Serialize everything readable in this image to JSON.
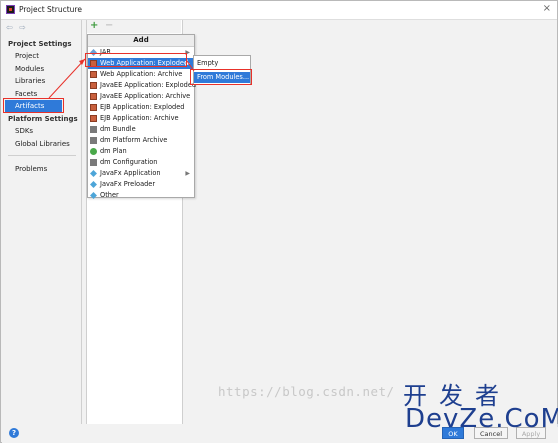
{
  "window": {
    "title": "Project Structure",
    "close_glyph": "×"
  },
  "nav": {
    "back_icon": "arrow-left-icon",
    "forward_icon": "arrow-right-icon",
    "glyphs": "⇦ ⇨"
  },
  "sidebar": {
    "project_settings_header": "Project Settings",
    "project_items": [
      "Project",
      "Modules",
      "Libraries",
      "Facets",
      "Artifacts"
    ],
    "platform_settings_header": "Platform Settings",
    "platform_items": [
      "SDKs",
      "Global Libraries"
    ],
    "other_items": [
      "Problems"
    ],
    "selected": "Artifacts"
  },
  "toolbar": {
    "add_glyph": "+",
    "remove_glyph": "−"
  },
  "add_menu": {
    "title": "Add",
    "items": [
      {
        "label": "JAR",
        "icon": "jar-icon",
        "submenu": true
      },
      {
        "label": "Web Application: Exploded",
        "icon": "web-exploded-icon",
        "submenu": true,
        "highlighted": true
      },
      {
        "label": "Web Application: Archive",
        "icon": "web-archive-icon"
      },
      {
        "label": "JavaEE Application: Exploded",
        "icon": "javaee-exploded-icon"
      },
      {
        "label": "JavaEE Application: Archive",
        "icon": "javaee-archive-icon"
      },
      {
        "label": "EJB Application: Exploded",
        "icon": "ejb-exploded-icon"
      },
      {
        "label": "EJB Application: Archive",
        "icon": "ejb-archive-icon"
      },
      {
        "label": "dm Bundle",
        "icon": "dm-bundle-icon"
      },
      {
        "label": "dm Platform Archive",
        "icon": "dm-platform-icon"
      },
      {
        "label": "dm Plan",
        "icon": "dm-plan-icon"
      },
      {
        "label": "dm Configuration",
        "icon": "dm-config-icon"
      },
      {
        "label": "JavaFx Application",
        "icon": "javafx-app-icon",
        "submenu": true
      },
      {
        "label": "JavaFx Preloader",
        "icon": "javafx-preloader-icon"
      },
      {
        "label": "Other",
        "icon": "other-icon"
      }
    ]
  },
  "submenu": {
    "items": [
      "Empty",
      "From Modules..."
    ],
    "highlighted": "From Modules..."
  },
  "footer": {
    "help_glyph": "?",
    "ok_label": "OK",
    "cancel_label": "Cancel",
    "apply_label": "Apply"
  },
  "watermark": {
    "url": "https://blog.csdn.net/",
    "cn": "开发者",
    "en": "DevZe.CoM"
  },
  "colors": {
    "selection": "#2f7ad9",
    "annotation_red": "#e8312a",
    "watermark_blue": "#1e3f8f"
  }
}
